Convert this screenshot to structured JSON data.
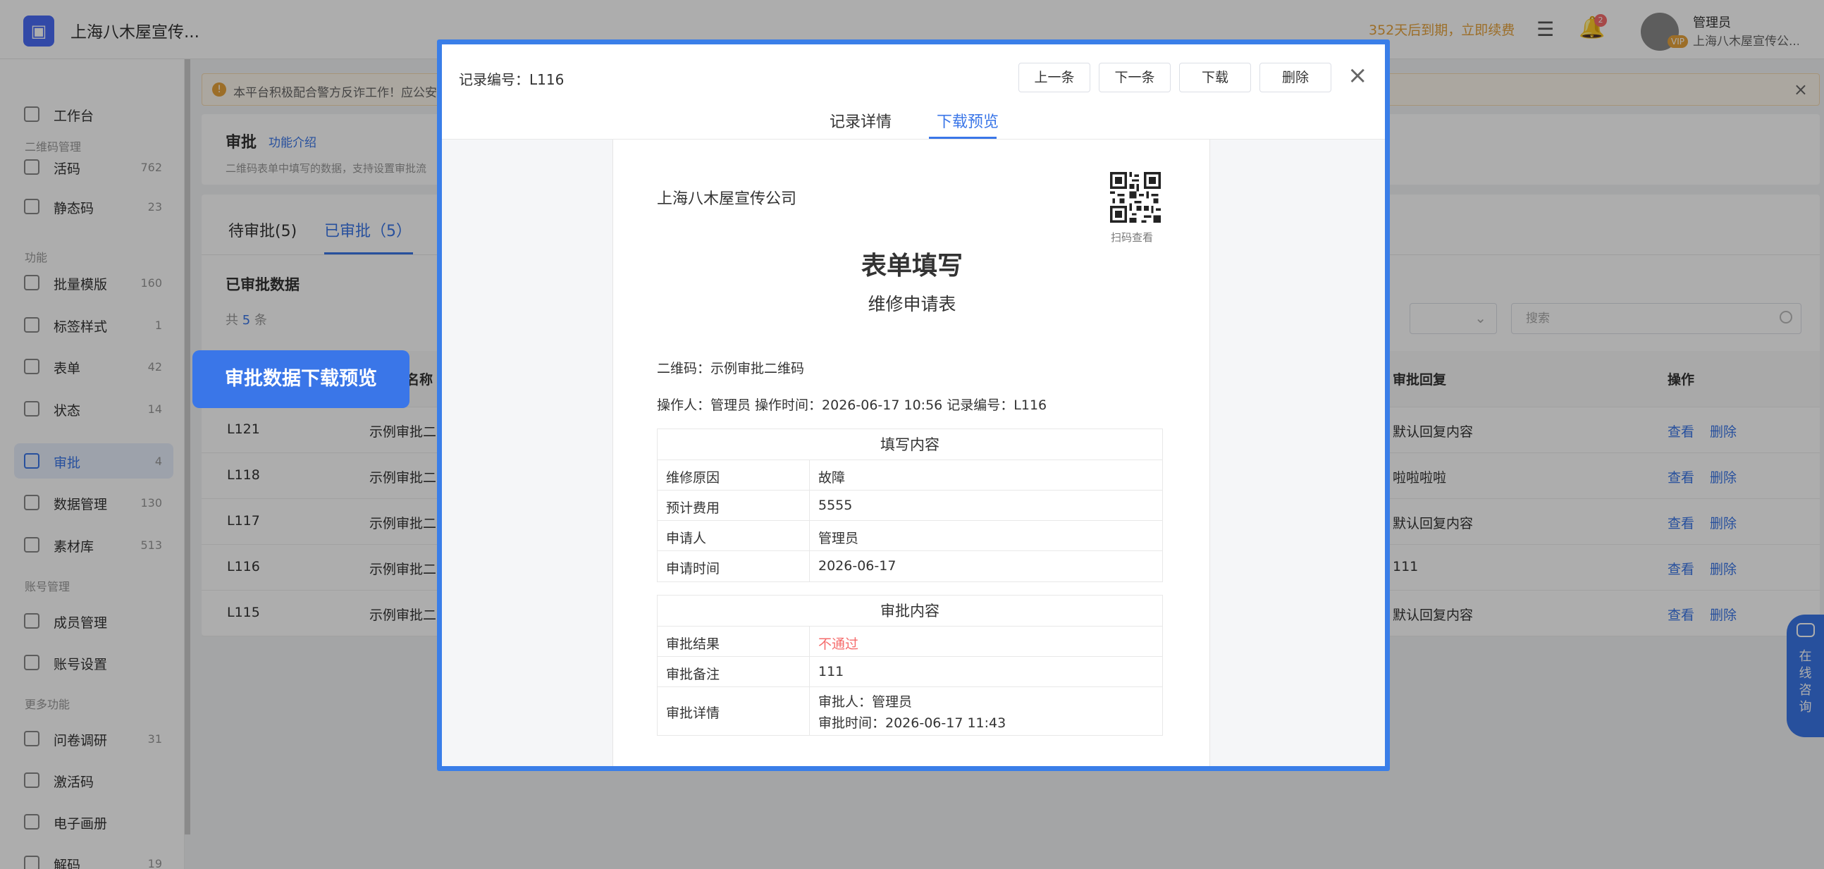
{
  "header": {
    "app_name": "上海八木屋宣传...",
    "renew_text": "352天后到期，立即续费",
    "notif_count": "2",
    "user_name": "管理员",
    "user_org": "上海八木屋宣传公...",
    "vip_label": "VIP"
  },
  "sidebar": {
    "items": [
      {
        "label": "工作台",
        "count": ""
      },
      {
        "label": "活码",
        "count": "762"
      },
      {
        "label": "静态码",
        "count": "23"
      },
      {
        "label": "批量模版",
        "count": "160"
      },
      {
        "label": "标签样式",
        "count": "1"
      },
      {
        "label": "表单",
        "count": "42"
      },
      {
        "label": "状态",
        "count": "14"
      },
      {
        "label": "审批",
        "count": "4"
      },
      {
        "label": "数据管理",
        "count": "130"
      },
      {
        "label": "素材库",
        "count": "513"
      },
      {
        "label": "成员管理",
        "count": ""
      },
      {
        "label": "账号设置",
        "count": ""
      },
      {
        "label": "问卷调研",
        "count": "31"
      },
      {
        "label": "激活码",
        "count": ""
      },
      {
        "label": "电子画册",
        "count": ""
      },
      {
        "label": "解码",
        "count": "19"
      }
    ],
    "sections": [
      "二维码管理",
      "功能",
      "账号管理",
      "更多功能"
    ]
  },
  "callout": "审批数据下载预览",
  "notice": "本平台积极配合警方反诈工作！应公安部",
  "page": {
    "title": "审批",
    "intro_link": "功能介绍",
    "desc": "二维码表单中填写的数据，支持设置审批流"
  },
  "tabs": {
    "pending": "待审批(5)",
    "approved": "已审批（5）"
  },
  "list": {
    "section_title": "已审批数据",
    "total_prefix": "共",
    "total_count": "5",
    "total_suffix": "条",
    "search_placeholder": "搜索",
    "columns": {
      "name": "名称",
      "reply": "审批回复",
      "ops": "操作"
    },
    "rows": [
      {
        "id": "L121",
        "name": "示例审批二",
        "reply": "默认回复内容"
      },
      {
        "id": "L118",
        "name": "示例审批二",
        "reply": "啦啦啦啦"
      },
      {
        "id": "L117",
        "name": "示例审批二",
        "reply": "默认回复内容"
      },
      {
        "id": "L116",
        "name": "示例审批二",
        "reply": "111"
      },
      {
        "id": "L115",
        "name": "示例审批二",
        "reply": "默认回复内容"
      }
    ],
    "view_label": "查看",
    "delete_label": "删除"
  },
  "modal": {
    "record_no": "记录编号：L116",
    "buttons": {
      "prev": "上一条",
      "next": "下一条",
      "download": "下载",
      "delete": "删除"
    },
    "tabs": {
      "detail": "记录详情",
      "preview": "下载预览"
    },
    "doc": {
      "company": "上海八木屋宣传公司",
      "qr_caption": "扫码查看",
      "title": "表单填写",
      "subtitle": "维修申请表",
      "qr_name": "二维码：示例审批二维码",
      "meta": "操作人：管理员    操作时间：2026-06-17 10:56    记录编号：L116",
      "fill_header": "填写内容",
      "fill_rows": [
        {
          "k": "维修原因",
          "v": "故障"
        },
        {
          "k": "预计费用",
          "v": "5555"
        },
        {
          "k": "申请人",
          "v": "管理员"
        },
        {
          "k": "申请时间",
          "v": "2026-06-17"
        }
      ],
      "approval_header": "审批内容",
      "approval_result_k": "审批结果",
      "approval_result_v": "不通过",
      "approval_note_k": "审批备注",
      "approval_note_v": "111",
      "approval_detail_k": "审批详情",
      "approval_detail_v1": "审批人：管理员",
      "approval_detail_v2": "审批时间：2026-06-17 11:43"
    }
  },
  "chat": "在线咨询",
  "colors": {
    "accent": "#3a76e8",
    "danger": "#f56c6c",
    "warning": "#e6a23c"
  }
}
